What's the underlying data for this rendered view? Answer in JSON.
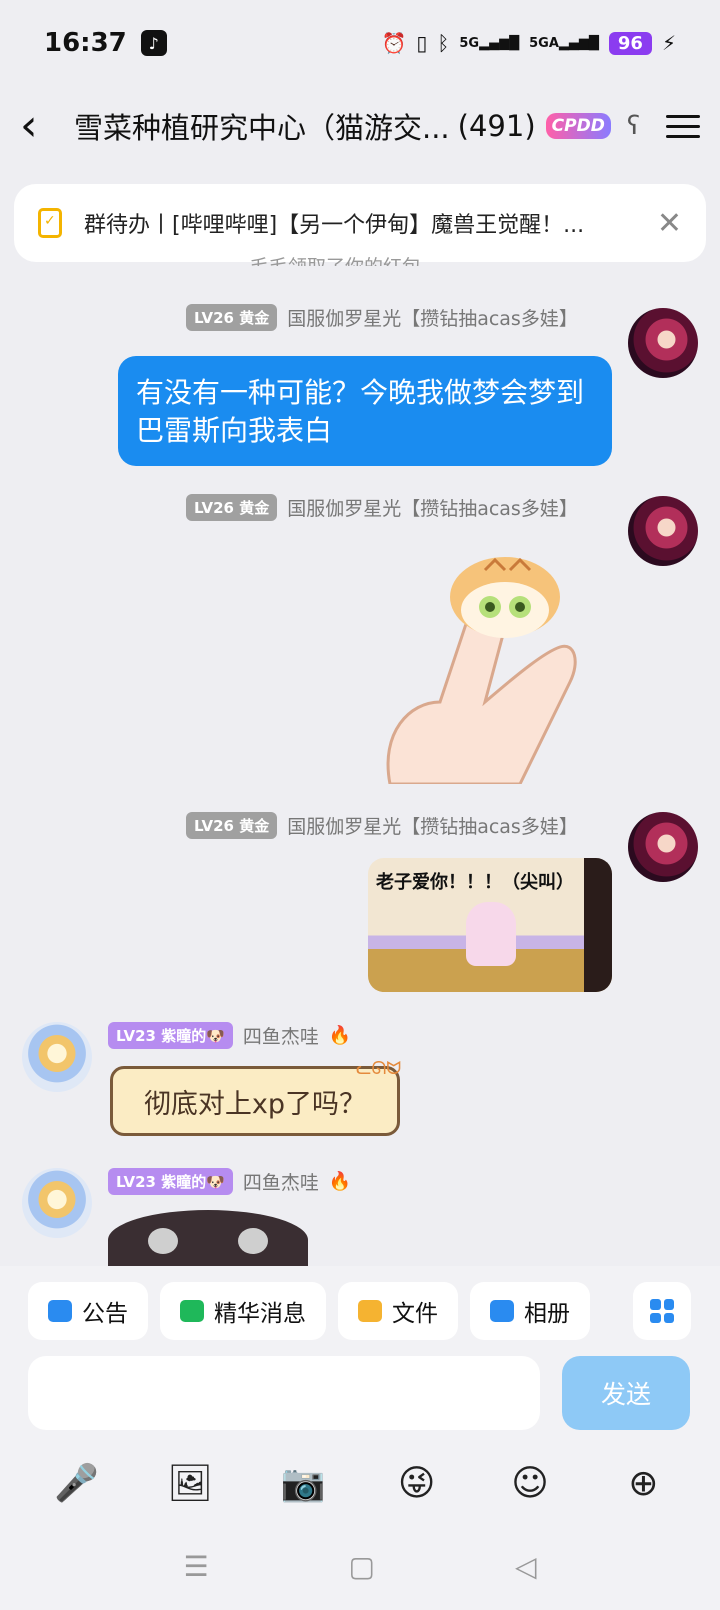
{
  "status": {
    "time": "16:37",
    "net1": "5G",
    "net2": "5GA",
    "battery": "96"
  },
  "header": {
    "title": "雪菜种植研究中心（猫游交...",
    "member_count": "(491)",
    "badge": "CPDD"
  },
  "todo": {
    "text": "群待办丨[哔哩哔哩]【另一个伊甸】魔兽王觉醒！..."
  },
  "system_note": "毛毛领取了你的红包",
  "messages": [
    {
      "level": "LV26 黄金",
      "sender": "国服伽罗星光【攒钻抽acas多娃】",
      "text": "有没有一种可能？今晚我做梦会梦到巴雷斯向我表白"
    },
    {
      "level": "LV26 黄金",
      "sender": "国服伽罗星光【攒钻抽acas多娃】",
      "sticker": "cat-on-finger"
    },
    {
      "level": "LV26 黄金",
      "sender": "国服伽罗星光【攒钻抽acas多娃】",
      "image_caption": "老子爱你！！！（尖叫）"
    },
    {
      "level": "LV23 紫瞳的🐶",
      "sender": "四鱼杰哇",
      "text": "彻底对上xp了吗？"
    },
    {
      "level": "LV23 紫瞳的🐶",
      "sender": "四鱼杰哇",
      "sticker": "dark-creature"
    }
  ],
  "chips": [
    "公告",
    "精华消息",
    "文件",
    "相册"
  ],
  "send_label": "发送",
  "colors": {
    "accent": "#1a8cf0",
    "send_disabled": "#8ec9f6",
    "level_gold": "#a0a0a0",
    "level_purple": "#b68cf0"
  }
}
